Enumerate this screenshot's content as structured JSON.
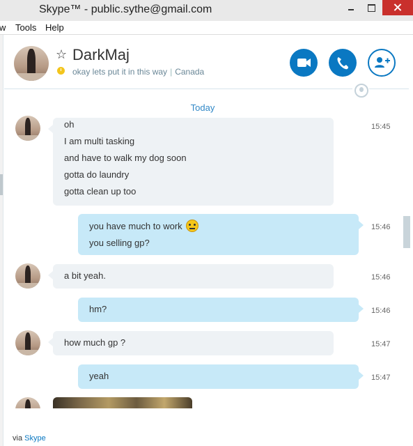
{
  "window": {
    "title": "Skype™ - public.sythe@gmail.com"
  },
  "menu": [
    "w",
    "Tools",
    "Help"
  ],
  "contact": {
    "name": "DarkMaj",
    "mood": "okay lets put it in this way",
    "location": "Canada"
  },
  "chat": {
    "date_label": "Today",
    "messages": [
      {
        "dir": "in",
        "lines": [
          "oh",
          "I am multi tasking",
          "and have to walk my dog soon",
          "gotta do laundry",
          "gotta clean up too"
        ],
        "time": "15:45"
      },
      {
        "dir": "out",
        "lines": [
          "you have much to work",
          "you selling gp?"
        ],
        "time": "15:46"
      },
      {
        "dir": "in",
        "lines": [
          "a bit yeah."
        ],
        "time": "15:46"
      },
      {
        "dir": "out",
        "lines": [
          "hm?"
        ],
        "time": "15:46"
      },
      {
        "dir": "in",
        "lines": [
          "how much gp ?"
        ],
        "time": "15:47"
      },
      {
        "dir": "out",
        "lines": [
          "yeah"
        ],
        "time": "15:47"
      }
    ]
  },
  "footer": {
    "prefix": "via",
    "link": "Skype"
  },
  "colors": {
    "accent": "#0a78c2",
    "incoming_bubble": "#eef2f5",
    "outgoing_bubble": "#c7e9f8",
    "status_away": "#f3c51d"
  },
  "icons": [
    "video-call-icon",
    "phone-call-icon",
    "add-contact-icon",
    "star-icon",
    "clock-icon",
    "globe-icon",
    "confused-emoji-icon"
  ]
}
